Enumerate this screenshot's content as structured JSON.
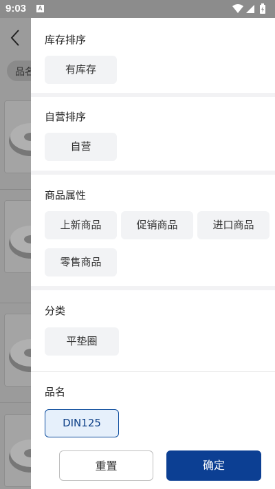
{
  "status_bar": {
    "time": "9:03",
    "notif_letter": "A"
  },
  "background": {
    "filter_label": "品名"
  },
  "drawer": {
    "stock_sort": {
      "title": "库存排序",
      "options": [
        "有库存"
      ]
    },
    "self_sort": {
      "title": "自营排序",
      "options": [
        "自营"
      ]
    },
    "attributes": {
      "title": "商品属性",
      "options": [
        "上新商品",
        "促销商品",
        "进口商品",
        "零售商品"
      ]
    },
    "category": {
      "title": "分类",
      "options": [
        "平垫圈"
      ]
    },
    "product_name": {
      "title": "品名",
      "options": [
        "DIN125"
      ],
      "selected": "DIN125"
    }
  },
  "actions": {
    "reset_label": "重置",
    "confirm_label": "确定"
  },
  "colors": {
    "accent": "#0c3f93",
    "chip_bg": "#f2f3f5",
    "selected_bg": "#e6f0fb"
  }
}
